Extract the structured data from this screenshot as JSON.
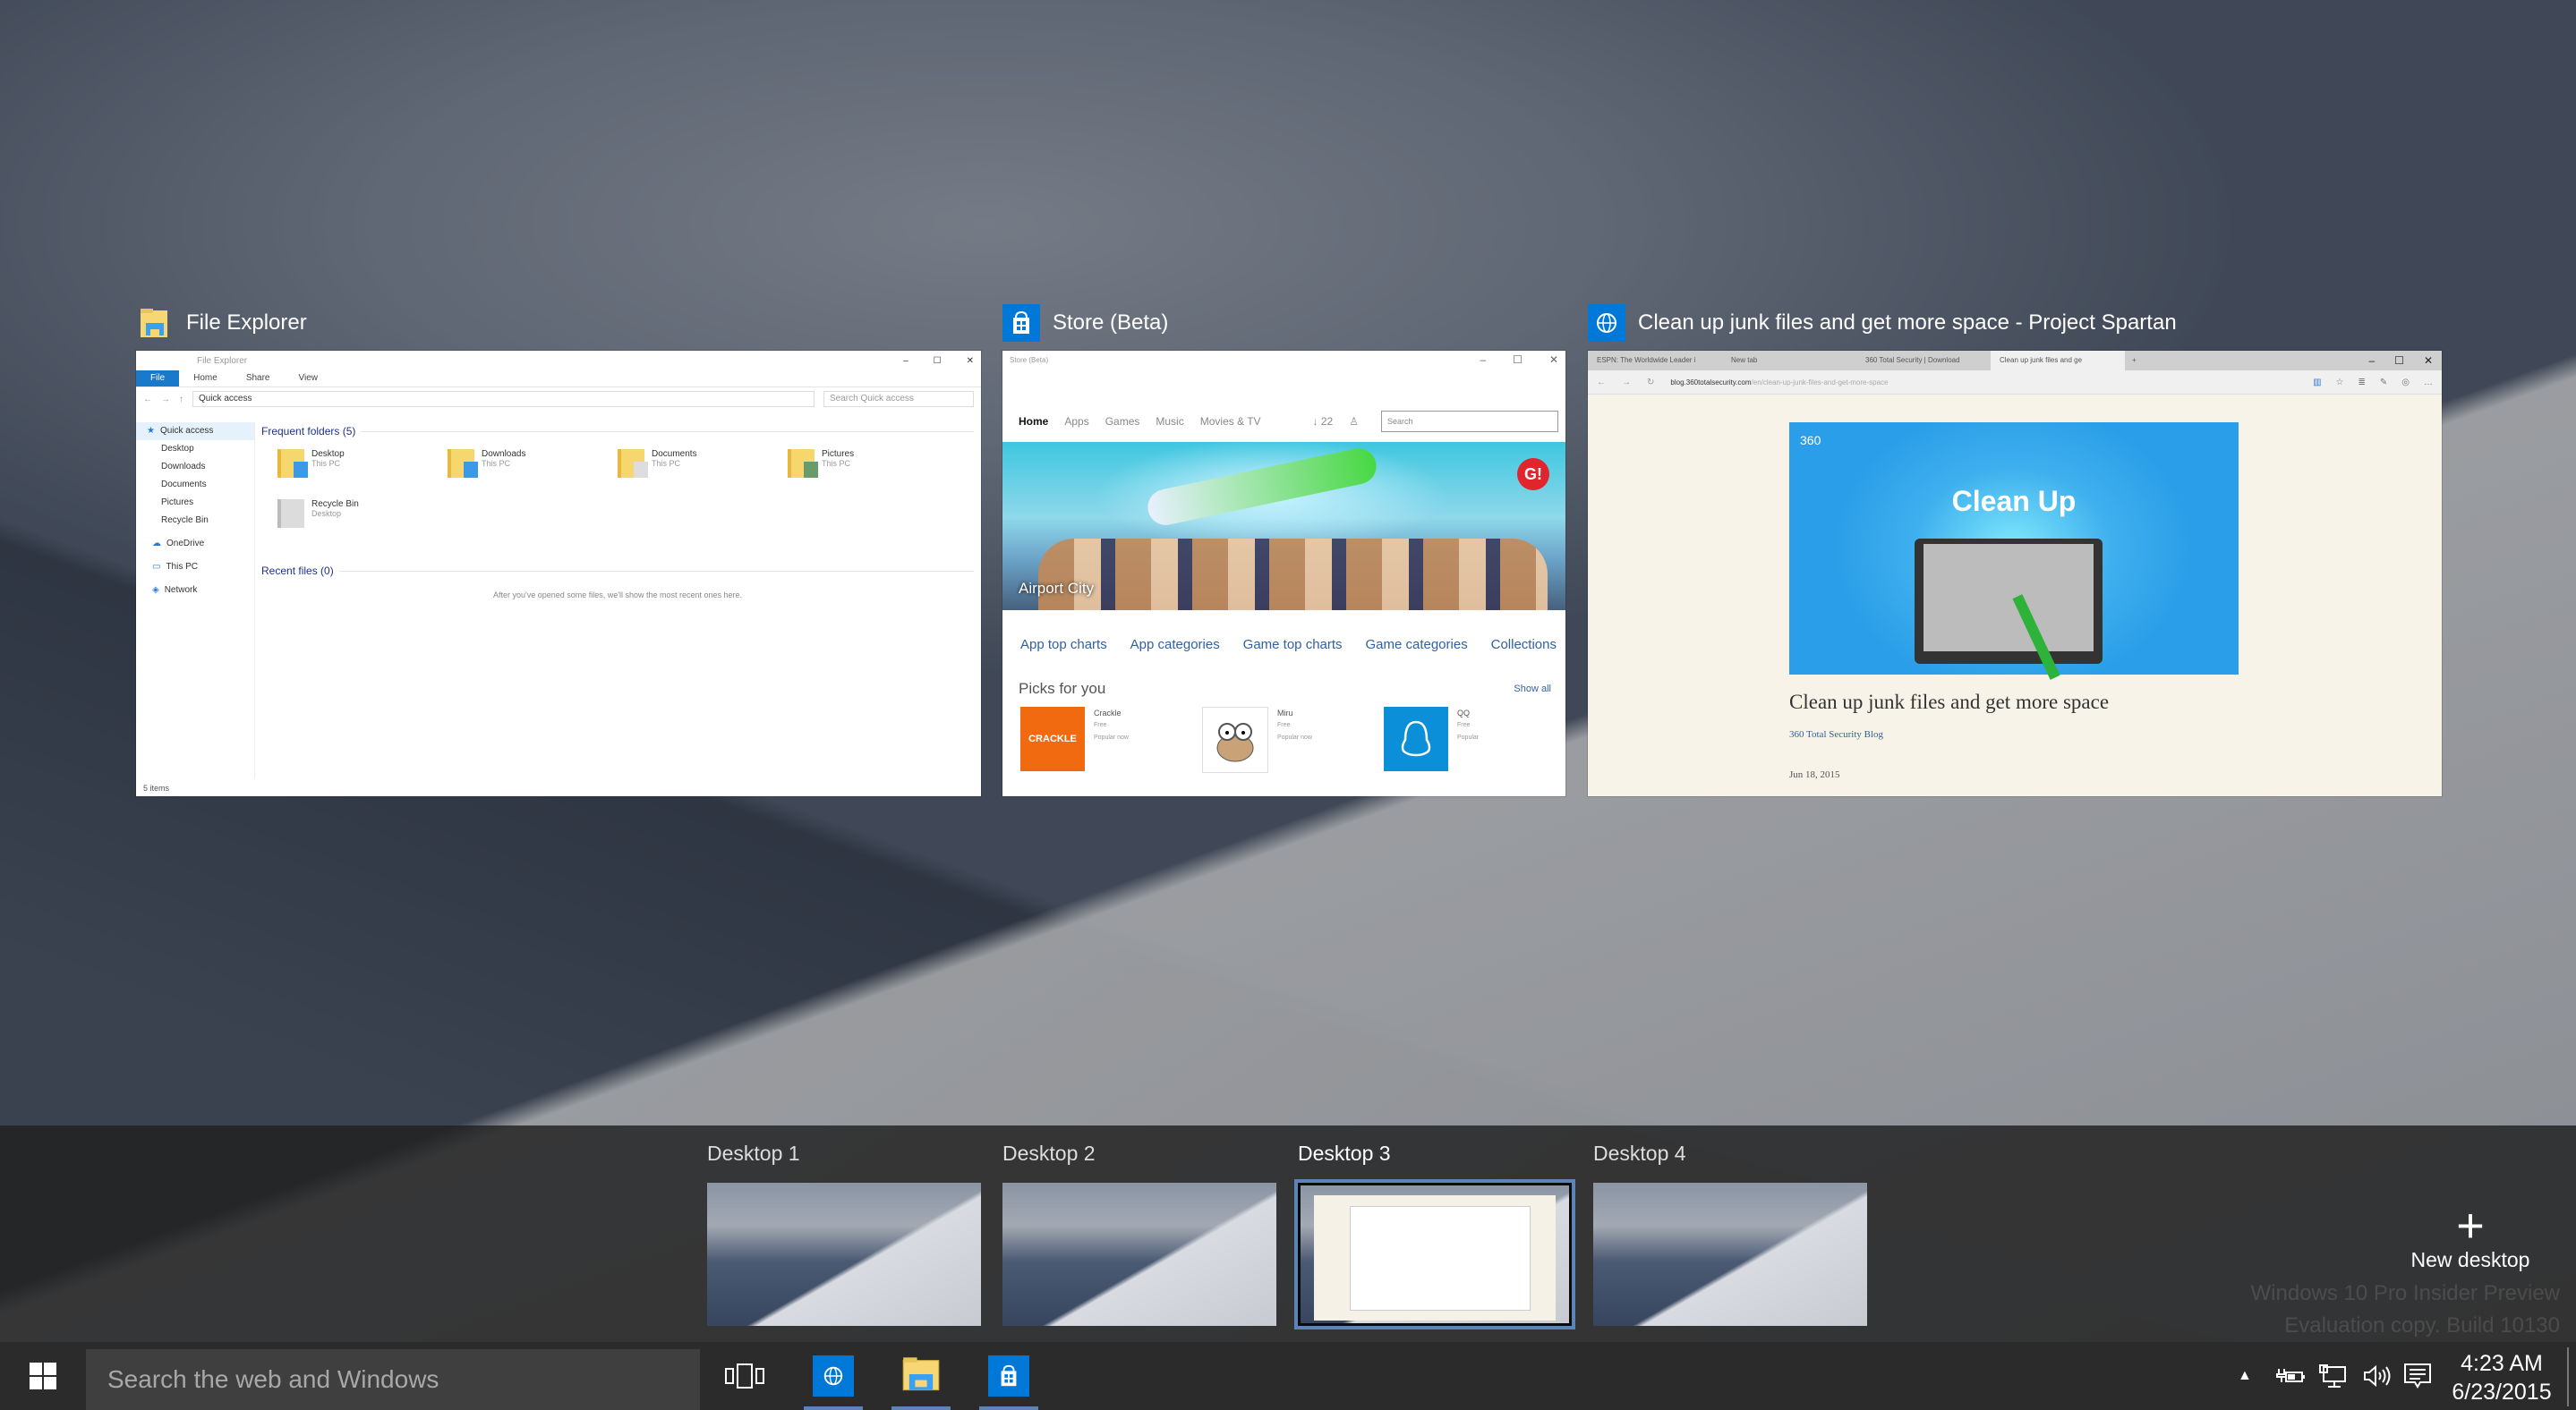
{
  "windows": [
    {
      "title": "File Explorer",
      "icon": "file-explorer-icon"
    },
    {
      "title": "Store (Beta)",
      "icon": "store-icon"
    },
    {
      "title": "Clean up junk files and get more space - Project Spartan",
      "icon": "spartan-globe-icon"
    }
  ],
  "file_explorer": {
    "titlebar": "File Explorer",
    "controls": [
      "–",
      "☐",
      "✕"
    ],
    "ribbon_tabs": [
      "File",
      "Home",
      "Share",
      "View"
    ],
    "address": "Quick access",
    "search_placeholder": "Search Quick access",
    "nav": [
      {
        "label": "Quick access",
        "type": "selected"
      },
      {
        "label": "Desktop",
        "type": "sub"
      },
      {
        "label": "Downloads",
        "type": "sub"
      },
      {
        "label": "Documents",
        "type": "sub"
      },
      {
        "label": "Pictures",
        "type": "sub"
      },
      {
        "label": "Recycle Bin",
        "type": "sub"
      },
      {
        "label": "OneDrive",
        "type": "top"
      },
      {
        "label": "This PC",
        "type": "top"
      },
      {
        "label": "Network",
        "type": "top"
      }
    ],
    "frequent_header": "Frequent folders (5)",
    "folders": [
      {
        "name": "Desktop",
        "location": "This PC"
      },
      {
        "name": "Downloads",
        "location": "This PC"
      },
      {
        "name": "Documents",
        "location": "This PC"
      },
      {
        "name": "Pictures",
        "location": "This PC"
      },
      {
        "name": "Recycle Bin",
        "location": "Desktop"
      }
    ],
    "recent_header": "Recent files (0)",
    "recent_empty": "After you've opened some files, we'll show the most recent ones here.",
    "status": "5 items"
  },
  "store": {
    "titlebar": "Store (Beta)",
    "controls": [
      "–",
      "☐",
      "✕"
    ],
    "menu": [
      "Home",
      "Apps",
      "Games",
      "Music",
      "Movies & TV"
    ],
    "downloads_badge": "↓ 22",
    "search_placeholder": "Search",
    "hero_caption": "Airport City",
    "hero_badge": "G!",
    "links": [
      "App top charts",
      "App categories",
      "Game top charts",
      "Game categories",
      "Collections"
    ],
    "picks_header": "Picks for you",
    "show_all": "Show all",
    "apps": [
      {
        "name": "Crackle",
        "price": "Free",
        "tag": "Popular now",
        "logo_text": "CRACKLE",
        "color": "#f26a10"
      },
      {
        "name": "Miru",
        "price": "Free",
        "tag": "Popular now",
        "logo_text": "◉◉",
        "color": "#ffffff"
      },
      {
        "name": "QQ",
        "price": "Free",
        "tag": "Popular",
        "logo_text": "QQ",
        "color": "#0a8fd8"
      }
    ]
  },
  "spartan": {
    "tabs": [
      {
        "label": "ESPN: The Worldwide Leader i",
        "active": false
      },
      {
        "label": "New tab",
        "active": false
      },
      {
        "label": "360 Total Security | Download",
        "active": false
      },
      {
        "label": "Clean up junk files and ge",
        "active": true
      }
    ],
    "new_tab": "+",
    "controls": [
      "–",
      "☐",
      "✕"
    ],
    "url_host": "blog.360totalsecurity.com",
    "url_path": "/en/clean-up-junk-files-and-get-more-space",
    "hero_logo": "360",
    "hero_title": "Clean Up",
    "article_title": "Clean up junk files and get more space",
    "byline": "360 Total Security Blog",
    "date": "Jun 18, 2015"
  },
  "desktops": {
    "items": [
      {
        "label": "Desktop 1",
        "current": false
      },
      {
        "label": "Desktop 2",
        "current": false
      },
      {
        "label": "Desktop 3",
        "current": true
      },
      {
        "label": "Desktop 4",
        "current": false
      }
    ],
    "new_desktop_label": "New desktop",
    "new_desktop_icon": "+"
  },
  "watermark": {
    "line1": "Windows 10 Pro Insider Preview",
    "line2": "Evaluation copy. Build 10130"
  },
  "taskbar": {
    "search_placeholder": "Search the web and Windows",
    "pinned": [
      "spartan-browser",
      "file-explorer",
      "store"
    ],
    "time": "4:23 AM",
    "date": "6/23/2015",
    "accent": "#0078d7"
  }
}
